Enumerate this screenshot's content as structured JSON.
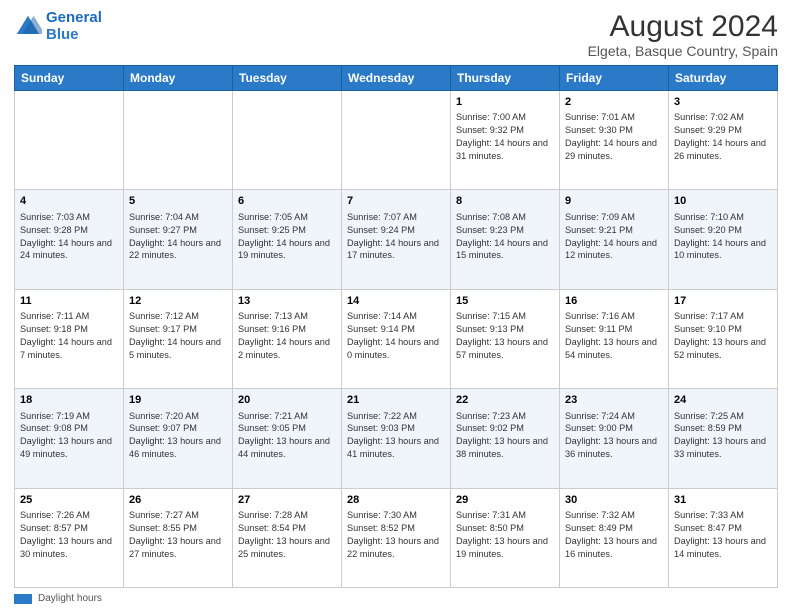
{
  "header": {
    "logo_line1": "General",
    "logo_line2": "Blue",
    "main_title": "August 2024",
    "subtitle": "Elgeta, Basque Country, Spain"
  },
  "days_of_week": [
    "Sunday",
    "Monday",
    "Tuesday",
    "Wednesday",
    "Thursday",
    "Friday",
    "Saturday"
  ],
  "legend_label": "Daylight hours",
  "weeks": [
    [
      {
        "day": "",
        "info": ""
      },
      {
        "day": "",
        "info": ""
      },
      {
        "day": "",
        "info": ""
      },
      {
        "day": "",
        "info": ""
      },
      {
        "day": "1",
        "info": "Sunrise: 7:00 AM\nSunset: 9:32 PM\nDaylight: 14 hours and 31 minutes."
      },
      {
        "day": "2",
        "info": "Sunrise: 7:01 AM\nSunset: 9:30 PM\nDaylight: 14 hours and 29 minutes."
      },
      {
        "day": "3",
        "info": "Sunrise: 7:02 AM\nSunset: 9:29 PM\nDaylight: 14 hours and 26 minutes."
      }
    ],
    [
      {
        "day": "4",
        "info": "Sunrise: 7:03 AM\nSunset: 9:28 PM\nDaylight: 14 hours and 24 minutes."
      },
      {
        "day": "5",
        "info": "Sunrise: 7:04 AM\nSunset: 9:27 PM\nDaylight: 14 hours and 22 minutes."
      },
      {
        "day": "6",
        "info": "Sunrise: 7:05 AM\nSunset: 9:25 PM\nDaylight: 14 hours and 19 minutes."
      },
      {
        "day": "7",
        "info": "Sunrise: 7:07 AM\nSunset: 9:24 PM\nDaylight: 14 hours and 17 minutes."
      },
      {
        "day": "8",
        "info": "Sunrise: 7:08 AM\nSunset: 9:23 PM\nDaylight: 14 hours and 15 minutes."
      },
      {
        "day": "9",
        "info": "Sunrise: 7:09 AM\nSunset: 9:21 PM\nDaylight: 14 hours and 12 minutes."
      },
      {
        "day": "10",
        "info": "Sunrise: 7:10 AM\nSunset: 9:20 PM\nDaylight: 14 hours and 10 minutes."
      }
    ],
    [
      {
        "day": "11",
        "info": "Sunrise: 7:11 AM\nSunset: 9:18 PM\nDaylight: 14 hours and 7 minutes."
      },
      {
        "day": "12",
        "info": "Sunrise: 7:12 AM\nSunset: 9:17 PM\nDaylight: 14 hours and 5 minutes."
      },
      {
        "day": "13",
        "info": "Sunrise: 7:13 AM\nSunset: 9:16 PM\nDaylight: 14 hours and 2 minutes."
      },
      {
        "day": "14",
        "info": "Sunrise: 7:14 AM\nSunset: 9:14 PM\nDaylight: 14 hours and 0 minutes."
      },
      {
        "day": "15",
        "info": "Sunrise: 7:15 AM\nSunset: 9:13 PM\nDaylight: 13 hours and 57 minutes."
      },
      {
        "day": "16",
        "info": "Sunrise: 7:16 AM\nSunset: 9:11 PM\nDaylight: 13 hours and 54 minutes."
      },
      {
        "day": "17",
        "info": "Sunrise: 7:17 AM\nSunset: 9:10 PM\nDaylight: 13 hours and 52 minutes."
      }
    ],
    [
      {
        "day": "18",
        "info": "Sunrise: 7:19 AM\nSunset: 9:08 PM\nDaylight: 13 hours and 49 minutes."
      },
      {
        "day": "19",
        "info": "Sunrise: 7:20 AM\nSunset: 9:07 PM\nDaylight: 13 hours and 46 minutes."
      },
      {
        "day": "20",
        "info": "Sunrise: 7:21 AM\nSunset: 9:05 PM\nDaylight: 13 hours and 44 minutes."
      },
      {
        "day": "21",
        "info": "Sunrise: 7:22 AM\nSunset: 9:03 PM\nDaylight: 13 hours and 41 minutes."
      },
      {
        "day": "22",
        "info": "Sunrise: 7:23 AM\nSunset: 9:02 PM\nDaylight: 13 hours and 38 minutes."
      },
      {
        "day": "23",
        "info": "Sunrise: 7:24 AM\nSunset: 9:00 PM\nDaylight: 13 hours and 36 minutes."
      },
      {
        "day": "24",
        "info": "Sunrise: 7:25 AM\nSunset: 8:59 PM\nDaylight: 13 hours and 33 minutes."
      }
    ],
    [
      {
        "day": "25",
        "info": "Sunrise: 7:26 AM\nSunset: 8:57 PM\nDaylight: 13 hours and 30 minutes."
      },
      {
        "day": "26",
        "info": "Sunrise: 7:27 AM\nSunset: 8:55 PM\nDaylight: 13 hours and 27 minutes."
      },
      {
        "day": "27",
        "info": "Sunrise: 7:28 AM\nSunset: 8:54 PM\nDaylight: 13 hours and 25 minutes."
      },
      {
        "day": "28",
        "info": "Sunrise: 7:30 AM\nSunset: 8:52 PM\nDaylight: 13 hours and 22 minutes."
      },
      {
        "day": "29",
        "info": "Sunrise: 7:31 AM\nSunset: 8:50 PM\nDaylight: 13 hours and 19 minutes."
      },
      {
        "day": "30",
        "info": "Sunrise: 7:32 AM\nSunset: 8:49 PM\nDaylight: 13 hours and 16 minutes."
      },
      {
        "day": "31",
        "info": "Sunrise: 7:33 AM\nSunset: 8:47 PM\nDaylight: 13 hours and 14 minutes."
      }
    ]
  ]
}
